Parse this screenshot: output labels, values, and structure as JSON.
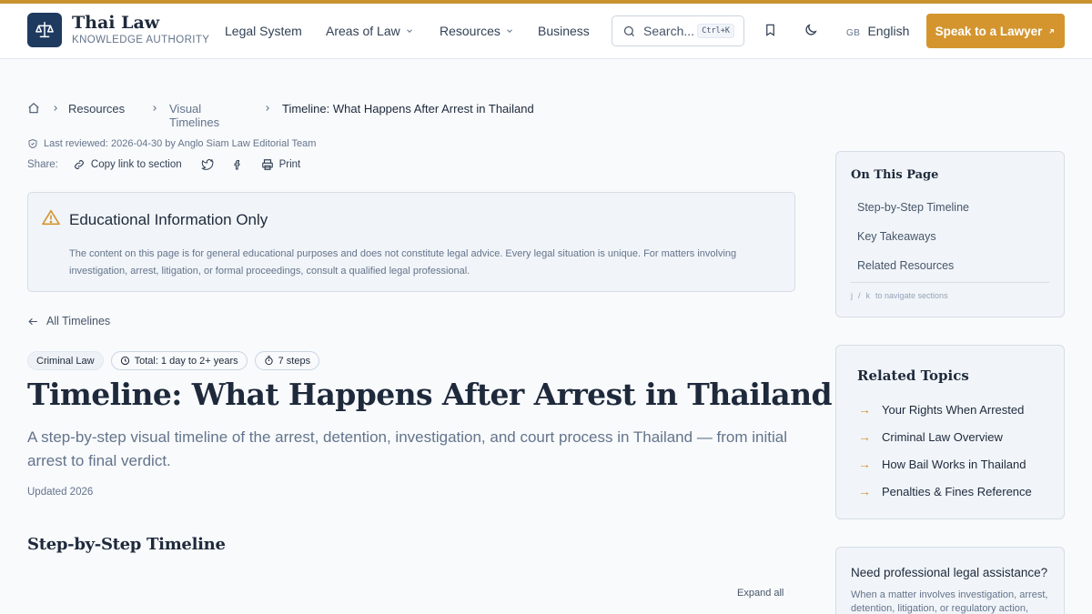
{
  "brand": {
    "title": "Thai Law",
    "subtitle": "KNOWLEDGE AUTHORITY"
  },
  "nav": {
    "legal_system": "Legal System",
    "areas_of_law": "Areas of Law",
    "resources": "Resources",
    "business": "Business"
  },
  "search": {
    "placeholder": "Search...",
    "shortcut": "Ctrl+K"
  },
  "language": {
    "flag": "GB",
    "label": "English"
  },
  "cta": {
    "label": "Speak to a Lawyer",
    "color": "#d4952f"
  },
  "breadcrumb": {
    "items": [
      "Resources",
      "Visual Timelines",
      "Timeline: What Happens After Arrest in Thailand"
    ]
  },
  "meta": {
    "last_reviewed": "Last reviewed: 2026-04-30 by Anglo Siam Law Editorial Team"
  },
  "share": {
    "label": "Share:",
    "copy_link": "Copy link to section",
    "print": "Print"
  },
  "notice": {
    "title": "Educational Information Only",
    "body": "The content on this page is for general educational purposes and does not constitute legal advice. Every legal situation is unique. For matters involving investigation, arrest, litigation, or formal proceedings, consult a qualified legal professional."
  },
  "back_link": "All Timelines",
  "tags": {
    "category": "Criminal Law",
    "total": "Total: 1 day to 2+ years",
    "steps": "7 steps"
  },
  "article": {
    "title": "Timeline: What Happens After Arrest in Thailand",
    "lede": "A step-by-step visual timeline of the arrest, detention, investigation, and court process in Thailand — from initial arrest to final verdict.",
    "updated": "Updated 2026",
    "section_title": "Step-by-Step Timeline",
    "expand_all": "Expand all"
  },
  "toc": {
    "title": "On This Page",
    "items": [
      "Step-by-Step Timeline",
      "Key Takeaways",
      "Related Resources"
    ],
    "hint_key1": "j",
    "hint_sep": "/",
    "hint_key2": "k",
    "hint_text": "to navigate sections"
  },
  "related": {
    "title": "Related Topics",
    "items": [
      "Your Rights When Arrested",
      "Criminal Law Overview",
      "How Bail Works in Thailand",
      "Penalties & Fines Reference"
    ]
  },
  "help": {
    "title": "Need professional legal assistance?",
    "body": "When a matter involves investigation, arrest, detention, litigation, or regulatory action,"
  },
  "colors": {
    "accent": "#d4952f",
    "brand_navy": "#1e3a5f"
  }
}
